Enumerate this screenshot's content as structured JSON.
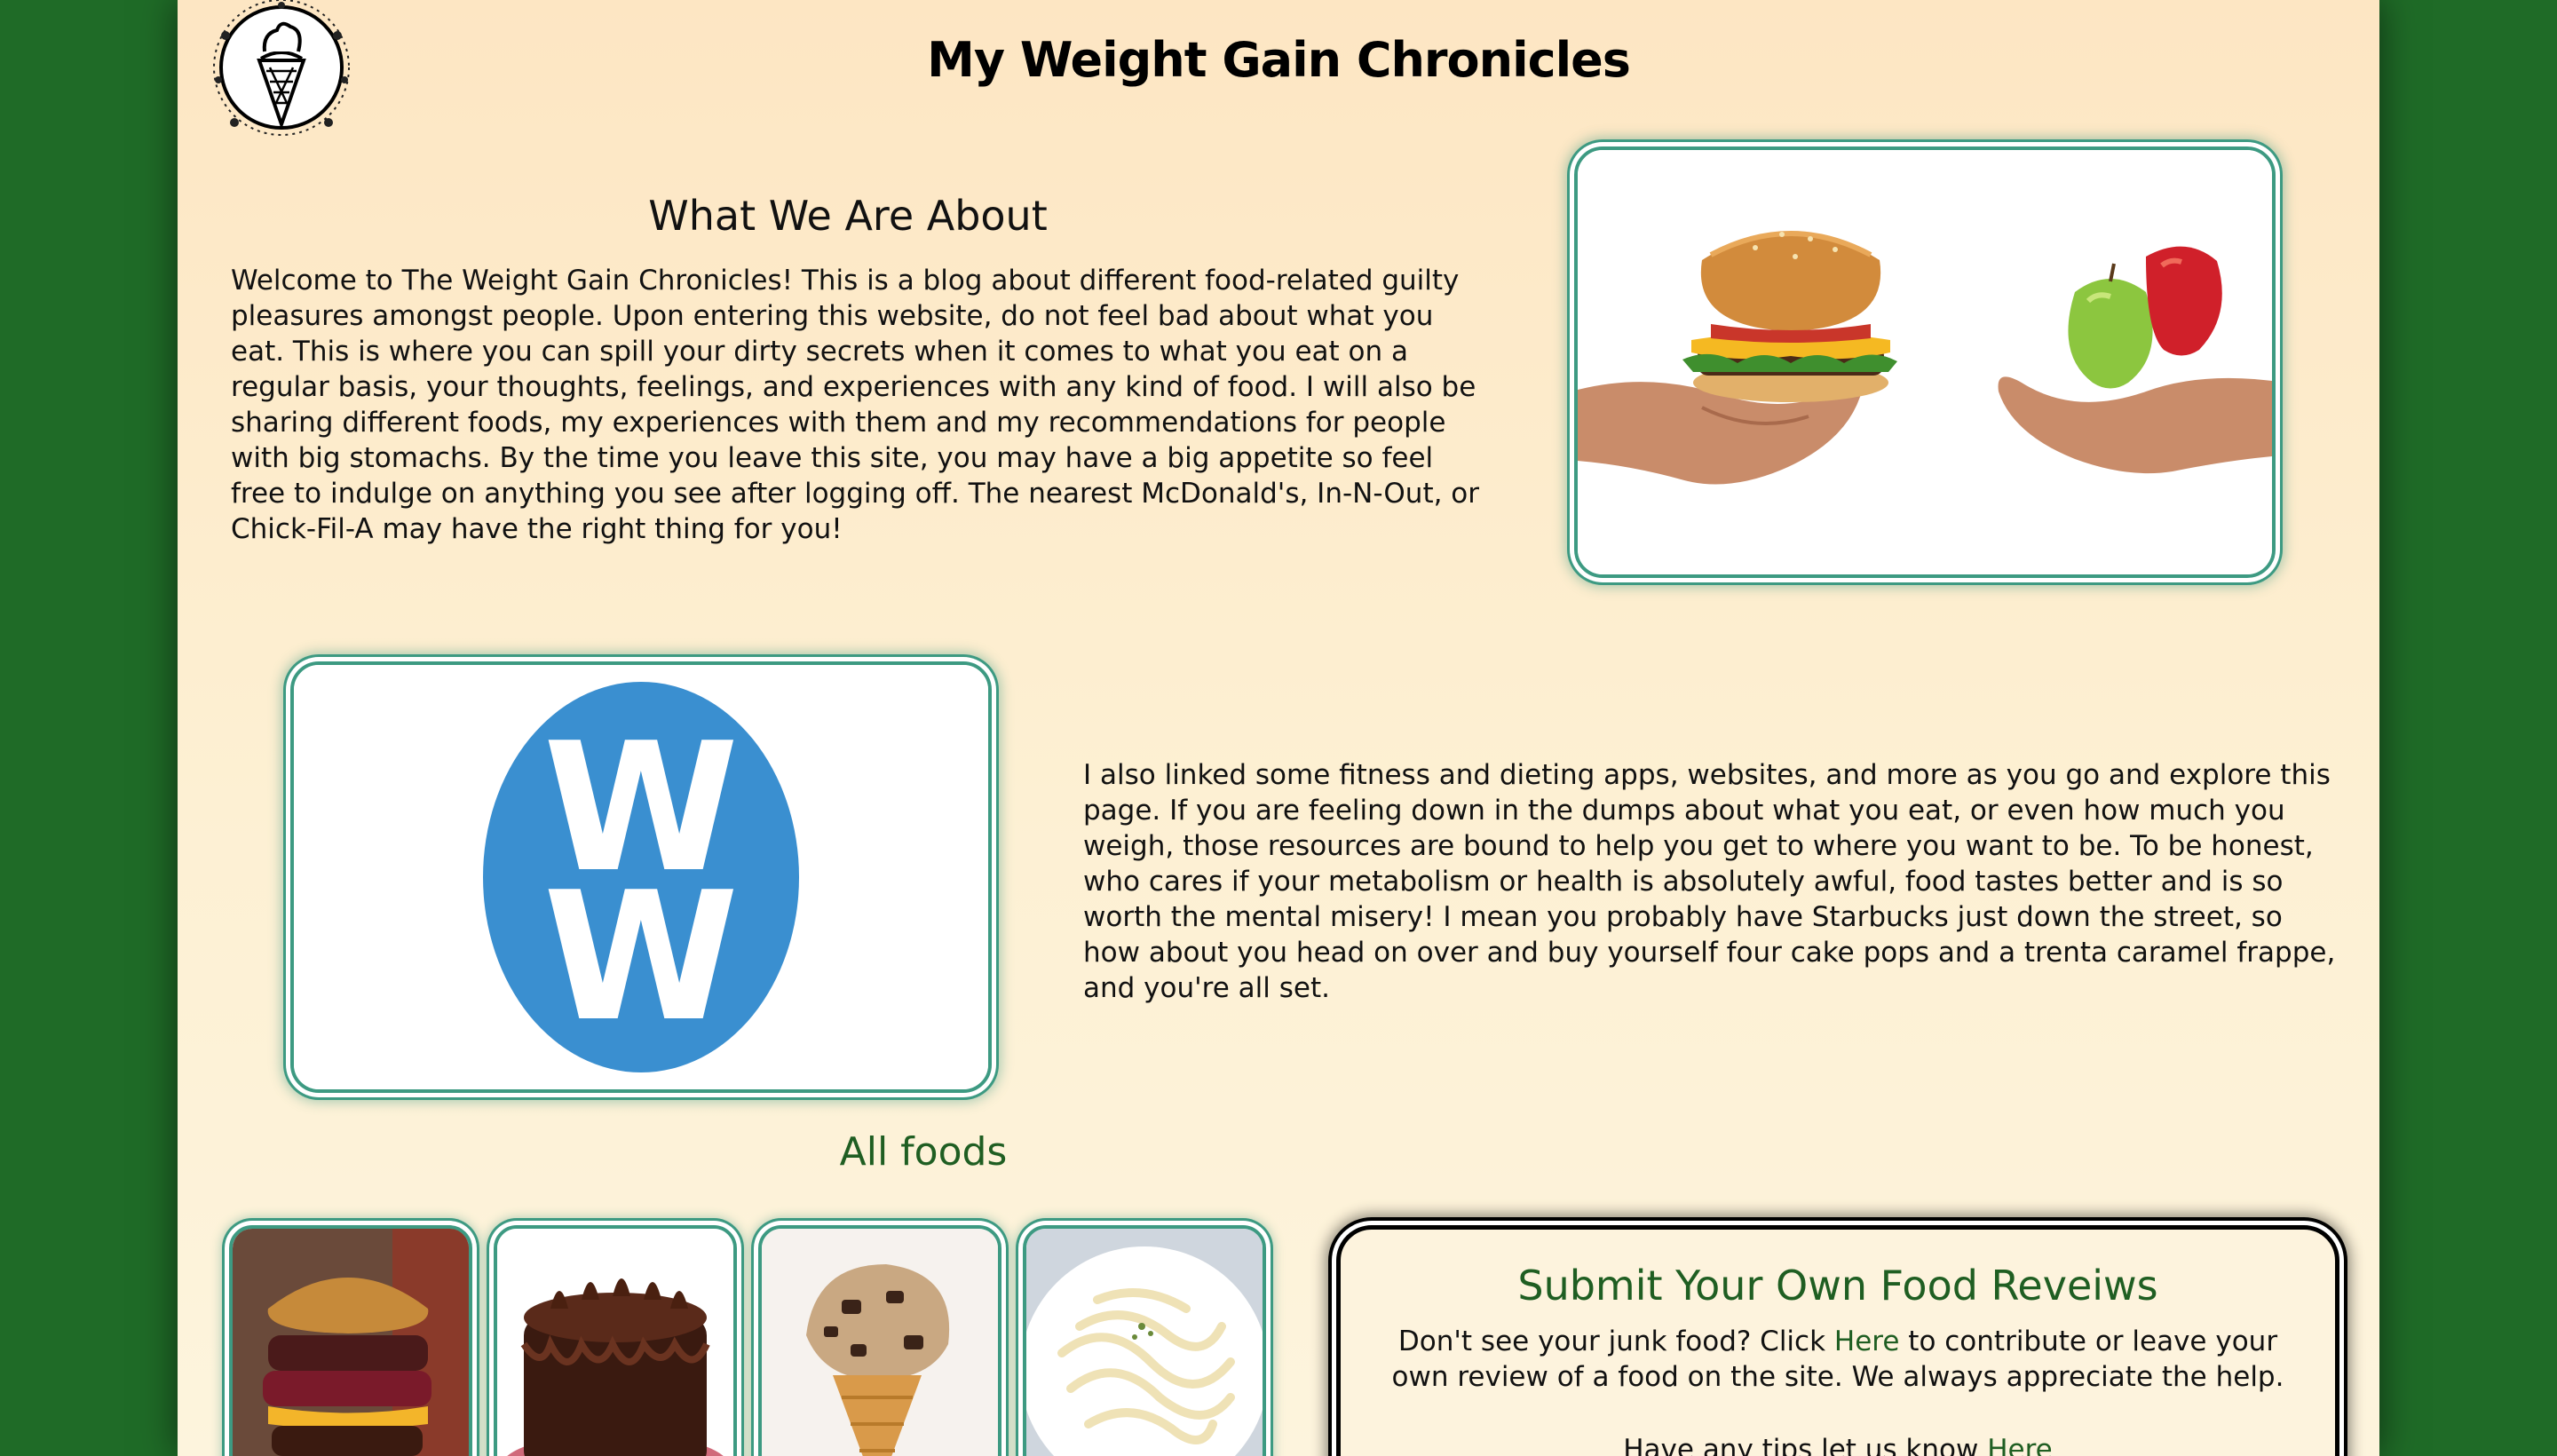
{
  "header": {
    "site_title": "My Weight Gain Chronicles"
  },
  "about": {
    "heading": "What We Are About",
    "body": "Welcome to The Weight Gain Chronicles! This is a blog about different food-related guilty pleasures amongst people. Upon entering this website, do not feel bad about what you eat. This is where you can spill your dirty secrets when it comes to what you eat on a regular basis, your thoughts, feelings, and experiences with any kind of food. I will also be sharing different foods, my experiences with them and my recommendations for people with big stomachs. By the time you leave this site, you may have a big appetite so feel free to indulge on anything you see after logging off. The nearest McDonald's, In-N-Out, or Chick-Fil-A may have the right thing for you!"
  },
  "resources": {
    "body": "I also linked some fitness and dieting apps, websites, and more as you go and explore this page. If you are feeling down in the dumps about what you eat, or even how much you weigh, those resources are bound to help you get to where you want to be. To be honest, who cares if your metabolism or health is absolutely awful, food tastes better and is so worth the mental misery! I mean you probably have Starbucks just down the street, so how about you head on over and buy yourself four cake pops and a trenta caramel frappe, and you're all set.",
    "ww_logo_text": "WW"
  },
  "foods": {
    "link_label": "All foods"
  },
  "submit": {
    "title": "Submit Your Own Food Reveiws",
    "line1_before": "Don't see your junk food? Click ",
    "line1_link": "Here",
    "line1_after": " to contribute or leave your own review of a food on the site. We always appreciate the help.",
    "line2_before": "Have any tips let us know ",
    "line2_link": "Here"
  },
  "colors": {
    "outer_background": "#1f6b27",
    "page_background": "#fde6c3",
    "frame_accent": "#3d9a82",
    "link_green": "#1f5e22",
    "ww_blue": "#3a8fd0"
  }
}
